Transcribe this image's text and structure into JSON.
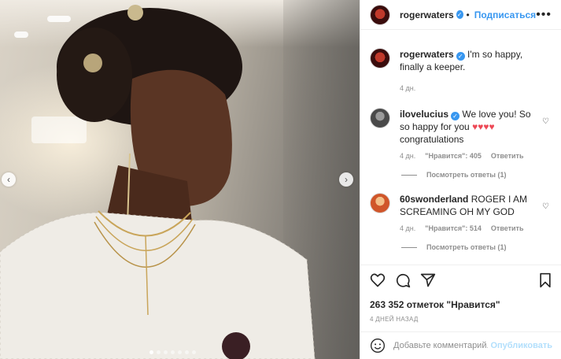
{
  "post": {
    "author": "rogerwaters",
    "follow_label": "Подписаться",
    "more_label": "•••",
    "verified_mark": "✓",
    "caption_text": "I'm so happy, finally a keeper.",
    "caption_time": "4 дн."
  },
  "comments": [
    {
      "user": "ilovelucius",
      "text": "We love you! So so happy for you",
      "hearts": "♥♥♥♥",
      "text_after": "congratulations",
      "time": "4 дн.",
      "likes": "\"Нравится\": 405",
      "reply": "Ответить",
      "view_replies": "Посмотреть ответы (1)"
    },
    {
      "user": "60swonderland",
      "text": "ROGER I AM SCREAMING OH MY GOD",
      "time": "4 дн.",
      "likes": "\"Нравится\": 514",
      "reply": "Ответить",
      "view_replies": "Посмотреть ответы (1)"
    }
  ],
  "actions": {
    "likes_count": "263 352 отметок \"Нравится\"",
    "time_ago": "4 ДНЕЙ НАЗАД"
  },
  "add_comment": {
    "placeholder": "Добавьте комментарий...",
    "publish_label": "Опубликовать"
  },
  "carousel": {
    "prev_label": "‹",
    "next_label": "›"
  },
  "icons": [
    "avatar",
    "verified-icon",
    "more-icon",
    "heart-icon",
    "comment-icon",
    "share-icon",
    "bookmark-icon",
    "emoji-icon",
    "chevron-left-icon",
    "chevron-right-icon"
  ],
  "colors": {
    "accent": "#3897f0",
    "heart_red": "#ed4956",
    "muted": "#8e8e8e",
    "publish_disabled": "#b2dffc"
  }
}
